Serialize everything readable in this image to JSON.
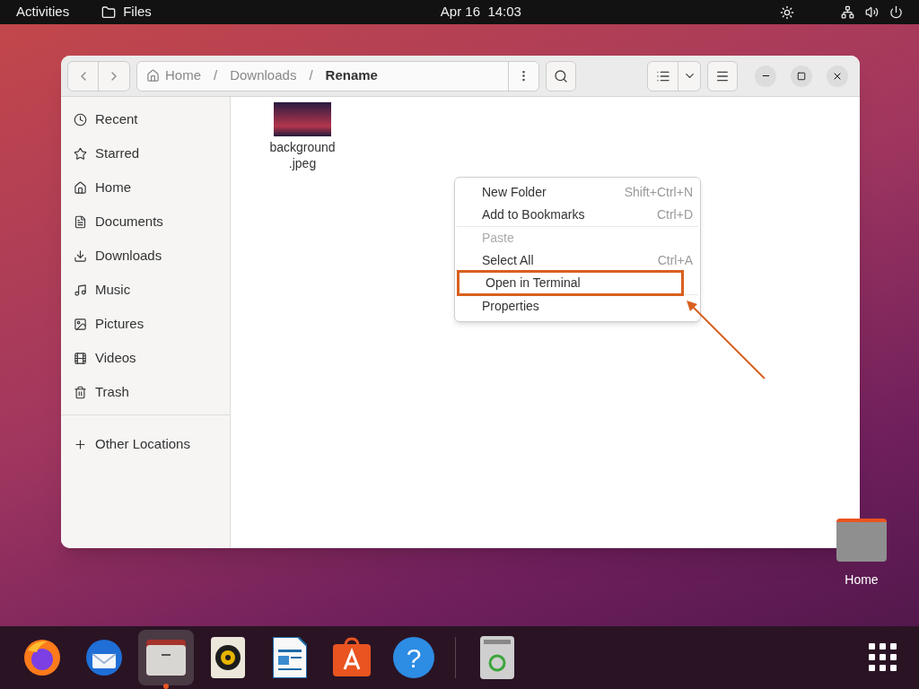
{
  "top_bar": {
    "activities": "Activities",
    "app_menu": "Files",
    "clock": "Apr 16  14:03"
  },
  "window": {
    "path": [
      {
        "label": "Home",
        "current": false
      },
      {
        "label": "Downloads",
        "current": false
      },
      {
        "label": "Rename",
        "current": true
      }
    ],
    "separator": "/"
  },
  "sidebar": {
    "items": [
      {
        "kind": "recent",
        "label": "Recent",
        "selected": false
      },
      {
        "kind": "starred",
        "label": "Starred",
        "selected": false
      },
      {
        "kind": "home",
        "label": "Home",
        "selected": false
      },
      {
        "kind": "documents",
        "label": "Documents",
        "selected": false
      },
      {
        "kind": "downloads",
        "label": "Downloads",
        "selected": false
      },
      {
        "kind": "music",
        "label": "Music",
        "selected": false
      },
      {
        "kind": "pictures",
        "label": "Pictures",
        "selected": false
      },
      {
        "kind": "videos",
        "label": "Videos",
        "selected": false
      },
      {
        "kind": "trash",
        "label": "Trash",
        "selected": false
      },
      {
        "kind": "other",
        "label": "Other Locations",
        "selected": false
      }
    ]
  },
  "files": [
    {
      "name_lines": [
        "background",
        ".jpeg"
      ]
    }
  ],
  "context_menu": [
    {
      "label": "New Folder",
      "shortcut": "Shift+Ctrl+N",
      "disabled": false,
      "annotated": false
    },
    {
      "label": "Add to Bookmarks",
      "shortcut": "Ctrl+D",
      "disabled": false,
      "annotated": false
    },
    {
      "label": "Paste",
      "disabled": true,
      "annotated": false
    },
    {
      "label": "Select All",
      "shortcut": "Ctrl+A",
      "disabled": false,
      "annotated": false
    },
    {
      "label": "Open in Terminal",
      "disabled": false,
      "annotated": true
    },
    {
      "label": "Properties",
      "disabled": false,
      "annotated": false
    }
  ],
  "desktop_icons": [
    {
      "label": "Home"
    }
  ],
  "dock": [
    {
      "kind": "firefox",
      "running": false
    },
    {
      "kind": "thunderbird",
      "running": false
    },
    {
      "kind": "files",
      "running": true
    },
    {
      "kind": "rhythmbox",
      "running": false
    },
    {
      "kind": "writer",
      "running": false
    },
    {
      "kind": "software",
      "running": false
    },
    {
      "kind": "help",
      "running": false,
      "glyph": "?"
    },
    {
      "kind": "separator"
    },
    {
      "kind": "trash",
      "running": false
    }
  ]
}
